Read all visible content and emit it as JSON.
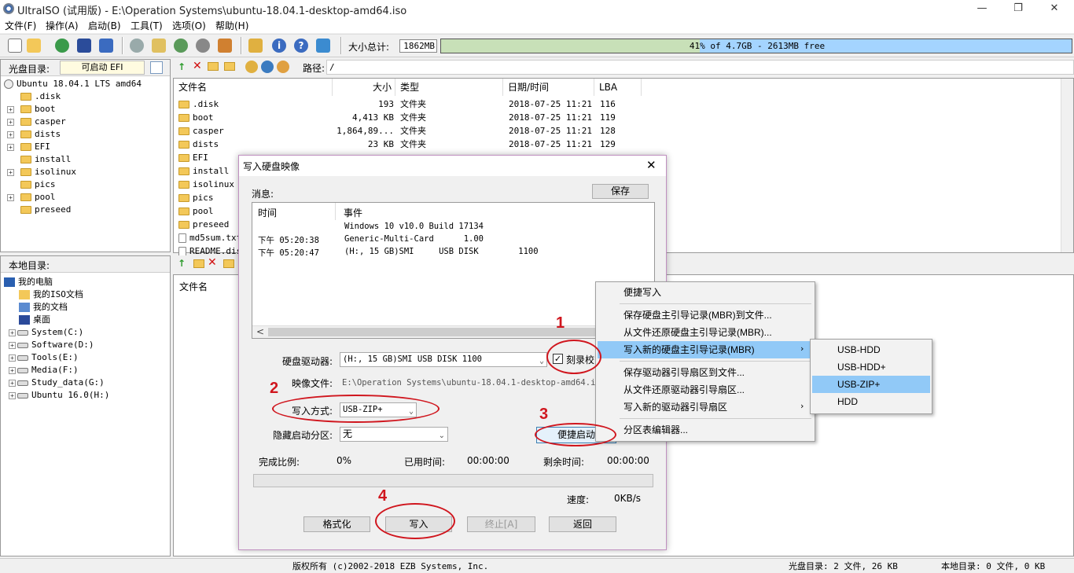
{
  "window": {
    "title": "UltraISO (试用版) - E:\\Operation Systems\\ubuntu-18.04.1-desktop-amd64.iso",
    "minimize": "—",
    "maximize": "❐",
    "close": "✕"
  },
  "menu": [
    "文件(F)",
    "操作(A)",
    "启动(B)",
    "工具(T)",
    "选项(O)",
    "帮助(H)"
  ],
  "toolbar": {
    "size_label": "大小总计:",
    "size_value": "1862MB",
    "capacity_text": "41% of 4.7GB - 2613MB free",
    "capacity_fraction": 0.41
  },
  "disc_pane": {
    "label": "光盘目录:",
    "boot_value": "可启动 EFI",
    "path_label": "路径:",
    "path_value": "/",
    "root": "Ubuntu 18.04.1 LTS amd64",
    "tree": [
      ".disk",
      "boot",
      "casper",
      "dists",
      "EFI",
      "install",
      "isolinux",
      "pics",
      "pool",
      "preseed"
    ],
    "expandable": [
      false,
      true,
      true,
      true,
      true,
      false,
      true,
      false,
      true,
      false
    ]
  },
  "file_list": {
    "columns": [
      "文件名",
      "大小",
      "类型",
      "日期/时间",
      "LBA"
    ],
    "rows": [
      {
        "name": ".disk",
        "size": "193",
        "type": "文件夹",
        "date": "2018-07-25 11:21",
        "lba": "116"
      },
      {
        "name": "boot",
        "size": "4,413 KB",
        "type": "文件夹",
        "date": "2018-07-25 11:21",
        "lba": "119"
      },
      {
        "name": "casper",
        "size": "1,864,89...",
        "type": "文件夹",
        "date": "2018-07-25 11:21",
        "lba": "128"
      },
      {
        "name": "dists",
        "size": "23 KB",
        "type": "文件夹",
        "date": "2018-07-25 11:21",
        "lba": "129"
      },
      {
        "name": "EFI",
        "size": "",
        "type": "",
        "date": "",
        "lba": ""
      },
      {
        "name": "install",
        "size": "",
        "type": "",
        "date": "",
        "lba": ""
      },
      {
        "name": "isolinux",
        "size": "",
        "type": "",
        "date": "",
        "lba": ""
      },
      {
        "name": "pics",
        "size": "",
        "type": "",
        "date": "",
        "lba": ""
      },
      {
        "name": "pool",
        "size": "",
        "type": "",
        "date": "",
        "lba": ""
      },
      {
        "name": "preseed",
        "size": "",
        "type": "",
        "date": "",
        "lba": ""
      },
      {
        "name": "md5sum.txt",
        "size": "",
        "type": "",
        "date": "",
        "lba": ""
      },
      {
        "name": "README.dis",
        "size": "",
        "type": "",
        "date": "",
        "lba": ""
      }
    ]
  },
  "local_pane": {
    "label": "本地目录:",
    "file_col": "文件名",
    "tree": [
      {
        "label": "我的电脑",
        "indent": 0,
        "type": "pc"
      },
      {
        "label": "我的ISO文档",
        "indent": 1,
        "type": "folder"
      },
      {
        "label": "我的文档",
        "indent": 1,
        "type": "doc"
      },
      {
        "label": "桌面",
        "indent": 1,
        "type": "desk"
      },
      {
        "label": "System(C:)",
        "indent": 1,
        "type": "drive"
      },
      {
        "label": "Software(D:)",
        "indent": 1,
        "type": "drive"
      },
      {
        "label": "Tools(E:)",
        "indent": 1,
        "type": "drive"
      },
      {
        "label": "Media(F:)",
        "indent": 1,
        "type": "drive"
      },
      {
        "label": "Study_data(G:)",
        "indent": 1,
        "type": "drive"
      },
      {
        "label": "Ubuntu 16.0(H:)",
        "indent": 1,
        "type": "drive"
      }
    ]
  },
  "status": {
    "copyright": "版权所有 (c)2002-2018 EZB Systems, Inc.",
    "disc": "光盘目录: 2 文件, 26 KB",
    "local": "本地目录: 0 文件, 0 KB"
  },
  "dialog": {
    "title": "写入硬盘映像",
    "close": "✕",
    "msg_label": "消息:",
    "save": "保存",
    "log_cols": [
      "时间",
      "事件"
    ],
    "log_rows": [
      {
        "time": "",
        "event": "Windows 10 v10.0 Build 17134"
      },
      {
        "time": "下午 05:20:38",
        "event": "Generic-Multi-Card      1.00"
      },
      {
        "time": "下午 05:20:47",
        "event": "(H:, 15 GB)SMI     USB DISK        1100"
      }
    ],
    "drive_label": "硬盘驱动器:",
    "drive_value": "(H:, 15 GB)SMI     USB DISK        1100",
    "verify_label": "刻录校",
    "image_label": "映像文件:",
    "image_value": "E:\\Operation Systems\\ubuntu-18.04.1-desktop-amd64.iso",
    "method_label": "写入方式:",
    "method_value": "USB-ZIP+",
    "hidden_label": "隐藏启动分区:",
    "hidden_value": "无",
    "quick_boot": "便捷启动",
    "progress_label": "完成比例:",
    "progress_value": "0%",
    "elapsed_label": "已用时间:",
    "elapsed_value": "00:00:00",
    "remaining_label": "剩余时间:",
    "remaining_value": "00:00:00",
    "speed_label": "速度:",
    "speed_value": "0KB/s",
    "btn_format": "格式化",
    "btn_write": "写入",
    "btn_stop": "终止[A]",
    "btn_back": "返回"
  },
  "context_menu": [
    "便捷写入",
    "保存硬盘主引导记录(MBR)到文件...",
    "从文件还原硬盘主引导记录(MBR)...",
    "写入新的硬盘主引导记录(MBR)",
    "保存驱动器引导扇区到文件...",
    "从文件还原驱动器引导扇区...",
    "写入新的驱动器引导扇区",
    "分区表编辑器..."
  ],
  "submenu": [
    "USB-HDD",
    "USB-HDD+",
    "USB-ZIP+",
    "HDD"
  ],
  "annotations": [
    "1",
    "2",
    "3",
    "4"
  ],
  "colors": {
    "highlight": "#91c9f7",
    "annotation": "#d0161e",
    "capacity": "#a4d4ff"
  }
}
